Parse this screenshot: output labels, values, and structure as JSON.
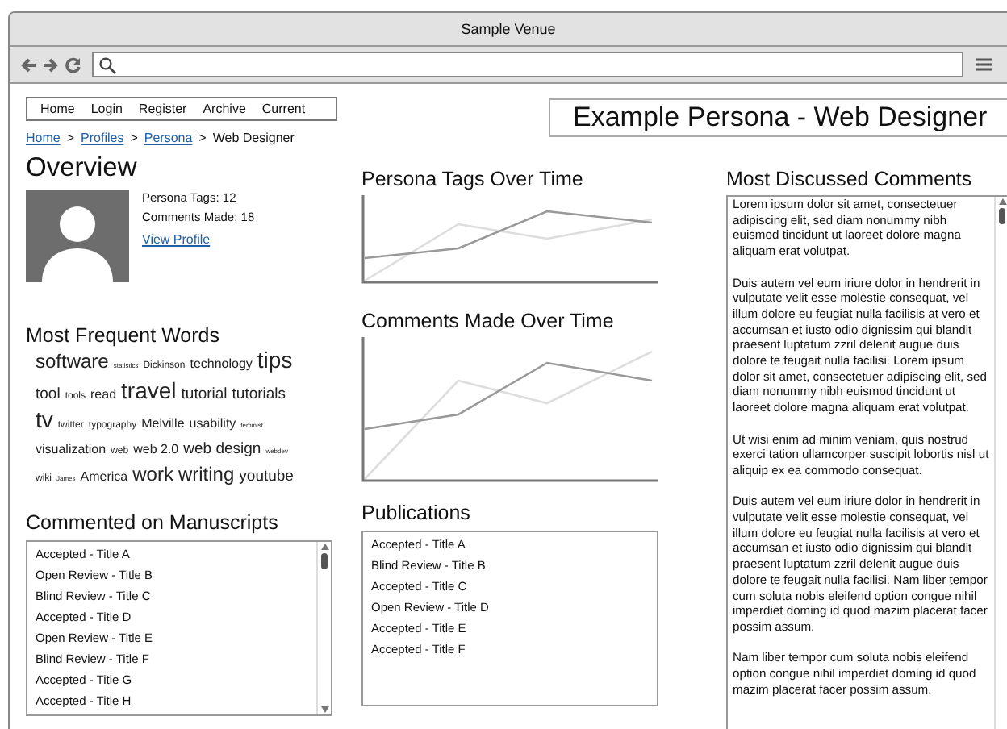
{
  "window": {
    "title": "Sample Venue"
  },
  "nav": [
    "Home",
    "Login",
    "Register",
    "Archive",
    "Current"
  ],
  "page_title": "Example Persona - Web Designer",
  "breadcrumb": {
    "links": [
      "Home",
      "Profiles",
      "Persona"
    ],
    "separator": ">",
    "current": "Web Designer"
  },
  "overview": {
    "heading": "Overview",
    "stats": [
      "Persona Tags: 12",
      "Comments Made: 18"
    ],
    "link": "View Profile"
  },
  "words": {
    "heading": "Most Frequent Words",
    "items": [
      {
        "text": "software",
        "kind": "xl"
      },
      {
        "text": "statistics",
        "kind": "xs"
      },
      {
        "text": "Dickinson",
        "kind": "s"
      },
      {
        "text": "technology",
        "kind": "m"
      },
      {
        "text": "tips",
        "kind": "xxl"
      },
      {
        "text": "tool",
        "kind": "l"
      },
      {
        "text": "tools",
        "kind": "s"
      },
      {
        "text": "read",
        "kind": "m"
      },
      {
        "text": "travel",
        "kind": "xxl"
      },
      {
        "text": "tutorial",
        "kind": "l"
      },
      {
        "text": "tutorials",
        "kind": "l"
      },
      {
        "text": "tv",
        "kind": "xxl"
      },
      {
        "text": "twitter",
        "kind": "s"
      },
      {
        "text": "typography",
        "kind": "s"
      },
      {
        "text": "Melville",
        "kind": "m"
      },
      {
        "text": "usability",
        "kind": "m"
      },
      {
        "text": "feminist",
        "kind": "xs"
      },
      {
        "text": "visualization",
        "kind": "m"
      },
      {
        "text": "web",
        "kind": "s"
      },
      {
        "text": "web 2.0",
        "kind": "m"
      },
      {
        "text": "web design",
        "kind": "l"
      },
      {
        "text": "webdev",
        "kind": "xs"
      },
      {
        "text": "wiki",
        "kind": "s"
      },
      {
        "text": "James",
        "kind": "xs"
      },
      {
        "text": "America",
        "kind": "m"
      },
      {
        "text": "work",
        "kind": "xl"
      },
      {
        "text": "writing",
        "kind": "xl"
      },
      {
        "text": "youtube",
        "kind": "l"
      }
    ]
  },
  "charts": [
    {
      "title": "Persona Tags Over Time",
      "kind": "short"
    },
    {
      "title": "Comments Made Over Time",
      "kind": "tall"
    }
  ],
  "manuscripts": {
    "heading": "Commented on Manuscripts",
    "items": [
      "Accepted - Title A",
      "Open Review - Title B",
      "Blind Review - Title C",
      "Accepted - Title D",
      "Open Review - Title E",
      "Blind Review - Title F",
      "Accepted - Title G",
      "Accepted - Title H"
    ]
  },
  "publications": {
    "heading": "Publications",
    "items": [
      "Accepted - Title A",
      "Blind Review - Title B",
      "Accepted - Title C",
      "Open Review - Title D",
      "Accepted - Title E",
      "Accepted - Title F"
    ]
  },
  "comments": {
    "heading": "Most Discussed Comments",
    "paragraphs": [
      "Lorem ipsum dolor sit amet, consectetuer adipiscing elit, sed diam nonummy nibh euismod tincidunt ut laoreet dolore magna aliquam erat volutpat.",
      "Duis autem vel eum iriure dolor in hendrerit in vulputate velit esse molestie consequat, vel illum dolore eu feugiat nulla facilisis at vero et accumsan et iusto odio dignissim qui blandit praesent luptatum zzril delenit augue duis dolore te feugait nulla facilisi. Lorem ipsum dolor sit amet, consectetuer adipiscing elit, sed diam nonummy nibh euismod tincidunt ut laoreet dolore magna aliquam erat volutpat.",
      "Ut wisi enim ad minim veniam, quis nostrud exerci tation ullamcorper suscipit lobortis nisl ut aliquip ex ea commodo consequat.",
      "Duis autem vel eum iriure dolor in hendrerit in vulputate velit esse molestie consequat, vel illum dolore eu feugiat nulla facilisis at vero et accumsan et iusto odio dignissim qui blandit praesent luptatum zzril delenit augue duis dolore te feugait nulla facilisi. Nam liber tempor cum soluta nobis eleifend option congue nihil imperdiet doming id quod mazim placerat facer possim assum.",
      "Nam liber tempor cum soluta nobis eleifend option congue nihil imperdiet doming id quod mazim placerat facer possim assum."
    ]
  }
}
